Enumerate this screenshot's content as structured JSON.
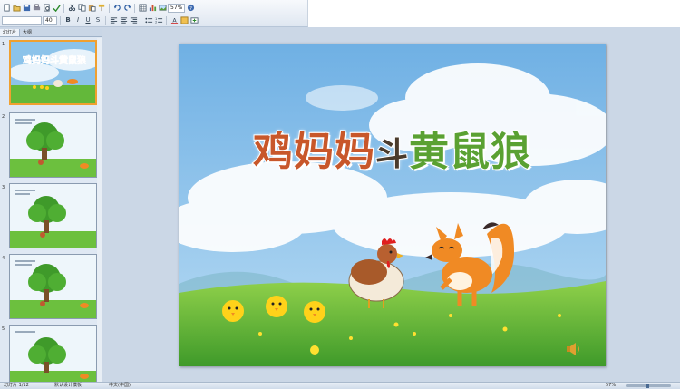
{
  "toolbar": {
    "font_size": "40",
    "icons_row1": [
      "new-icon",
      "open-icon",
      "save-icon",
      "print-icon",
      "print-preview-icon",
      "spell-check-icon",
      "cut-icon",
      "copy-icon",
      "paste-icon",
      "format-painter-icon",
      "undo-icon",
      "redo-icon",
      "table-icon",
      "chart-icon",
      "insert-picture-icon",
      "zoom-icon",
      "help-icon"
    ],
    "icons_row2": [
      "bold-icon",
      "italic-icon",
      "underline-icon",
      "shadow-icon",
      "align-left-icon",
      "center-icon",
      "align-right-icon",
      "bullets-icon",
      "numbering-icon",
      "font-color-icon",
      "design-icon",
      "new-slide-icon"
    ]
  },
  "panel": {
    "tabs": [
      "幻灯片",
      "大纲"
    ],
    "slides": [
      {
        "number": "1",
        "selected": true
      },
      {
        "number": "2",
        "selected": false
      },
      {
        "number": "3",
        "selected": false
      },
      {
        "number": "4",
        "selected": false
      },
      {
        "number": "5",
        "selected": false
      }
    ]
  },
  "slide": {
    "title_part1": "鸡妈妈",
    "title_part2": "斗",
    "title_part3": "黄鼠狼",
    "colors": {
      "sky": "#7fb8e6",
      "grass": "#5cb832",
      "title_brown": "#c8572a",
      "title_green": "#5aa132",
      "fox": "#f08a24"
    }
  },
  "status": {
    "slide_info": "幻灯片 1/12",
    "theme": "默认设计模板",
    "language": "中文(中国)",
    "zoom": "57%"
  }
}
